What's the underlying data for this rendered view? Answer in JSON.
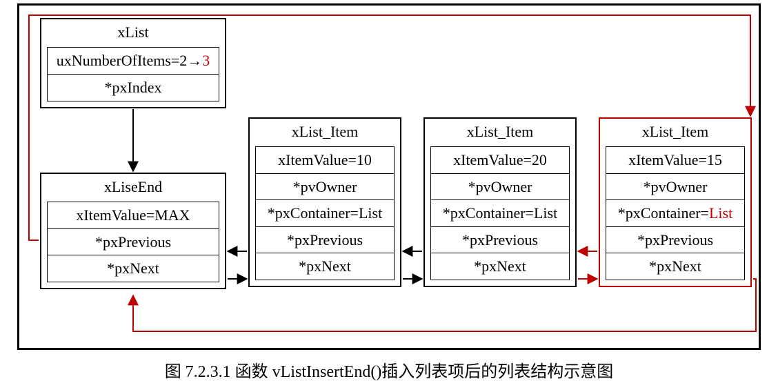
{
  "caption": "图 7.2.3.1 函数 vListInsertEnd()插入列表项后的列表结构示意图",
  "xlist": {
    "title": "xList",
    "count_label": "uxNumberOfItems=2→",
    "count_new": "3",
    "pxIndex": "*pxIndex"
  },
  "xlistend": {
    "title": "xLiseEnd",
    "itemValue": "xItemValue=MAX",
    "pxPrevious": "*pxPrevious",
    "pxNext": "*pxNext"
  },
  "item1": {
    "title": "xList_Item",
    "itemValue": "xItemValue=10",
    "pvOwner": "*pvOwner",
    "pxContainer": "*pxContainer=List",
    "pxPrevious": "*pxPrevious",
    "pxNext": "*pxNext"
  },
  "item2": {
    "title": "xList_Item",
    "itemValue": "xItemValue=20",
    "pvOwner": "*pvOwner",
    "pxContainer": "*pxContainer=List",
    "pxPrevious": "*pxPrevious",
    "pxNext": "*pxNext"
  },
  "item3": {
    "title": "xList_Item",
    "itemValue": "xItemValue=15",
    "pvOwner": "*pvOwner",
    "pxContainerPrefix": "*pxContainer=",
    "pxContainerVal": "List",
    "pxPrevious": "*pxPrevious",
    "pxNext": "*pxNext"
  }
}
